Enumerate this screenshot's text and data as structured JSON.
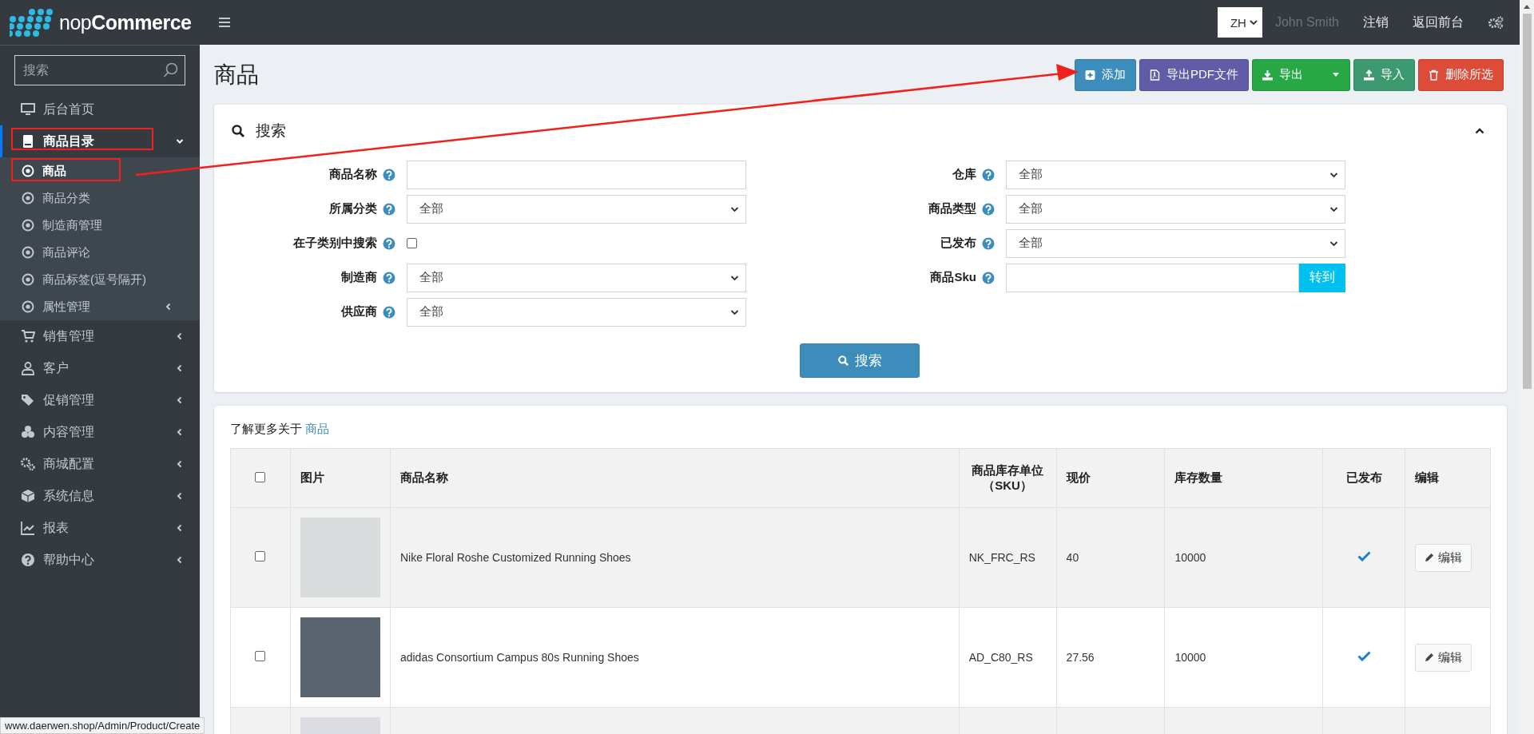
{
  "brand": {
    "name_light": "nop",
    "name_bold": "Commerce"
  },
  "sidebar": {
    "search": {
      "placeholder": "搜索"
    },
    "items": [
      {
        "label": "后台首页",
        "selected": false,
        "has_arrow": false
      },
      {
        "label": "商品目录",
        "selected": true,
        "expanded": true,
        "has_arrow": true,
        "children": [
          {
            "label": "商品",
            "selected": true,
            "has_arrow": false
          },
          {
            "label": "商品分类",
            "selected": false,
            "has_arrow": false
          },
          {
            "label": "制造商管理",
            "selected": false,
            "has_arrow": false
          },
          {
            "label": "商品评论",
            "selected": false,
            "has_arrow": false
          },
          {
            "label": "商品标签(逗号隔开)",
            "selected": false,
            "has_arrow": false
          },
          {
            "label": "属性管理",
            "selected": false,
            "has_arrow": true
          }
        ]
      },
      {
        "label": "销售管理",
        "selected": false,
        "expanded": false,
        "has_arrow": true
      },
      {
        "label": "客户",
        "selected": false,
        "expanded": false,
        "has_arrow": true
      },
      {
        "label": "促销管理",
        "selected": false,
        "expanded": false,
        "has_arrow": true
      },
      {
        "label": "内容管理",
        "selected": false,
        "expanded": false,
        "has_arrow": true
      },
      {
        "label": "商城配置",
        "selected": false,
        "expanded": false,
        "has_arrow": true
      },
      {
        "label": "系统信息",
        "selected": false,
        "expanded": false,
        "has_arrow": true
      },
      {
        "label": "报表",
        "selected": false,
        "expanded": false,
        "has_arrow": true
      },
      {
        "label": "帮助中心",
        "selected": false,
        "expanded": false,
        "has_arrow": true
      }
    ]
  },
  "header": {
    "language": "ZH",
    "user": "John Smith",
    "logout": "注销",
    "storefront": "返回前台"
  },
  "page_title": "商品",
  "actions": [
    {
      "kind": "add",
      "label": "添加"
    },
    {
      "kind": "pdf",
      "label": "导出PDF文件"
    },
    {
      "kind": "export",
      "label": "导出"
    },
    {
      "kind": "import",
      "label": "导入"
    },
    {
      "kind": "delete",
      "label": "删除所选"
    }
  ],
  "search_panel": {
    "title": "搜索",
    "expanded": true,
    "left_fields": [
      {
        "kind": "text",
        "label": "商品名称"
      },
      {
        "kind": "select",
        "label": "所属分类",
        "value": "全部"
      },
      {
        "kind": "checkbox",
        "label": "在子类别中搜索",
        "checked": false
      },
      {
        "kind": "select",
        "label": "制造商",
        "value": "全部"
      },
      {
        "kind": "select",
        "label": "供应商",
        "value": "全部"
      }
    ],
    "right_fields": [
      {
        "kind": "select",
        "label": "仓库",
        "value": "全部"
      },
      {
        "kind": "select",
        "label": "商品类型",
        "value": "全部"
      },
      {
        "kind": "select",
        "label": "已发布",
        "value": "全部"
      },
      {
        "kind": "go",
        "label": "商品Sku",
        "button": "转到"
      }
    ],
    "search_button": "搜索"
  },
  "learn_more": {
    "text": "了解更多关于",
    "link": "商品"
  },
  "table": {
    "columns": [
      "图片",
      "商品名称",
      "商品库存单位（SKU）",
      "现价",
      "库存数量",
      "已发布",
      "编辑"
    ],
    "select_all_checked": false,
    "rows": [
      {
        "kind": "full",
        "checked": false,
        "name": "Nike Floral Roshe Customized Running Shoes",
        "sku": "NK_FRC_RS",
        "price": "40",
        "stock": "10000",
        "published": true,
        "edit": "编辑"
      },
      {
        "kind": "full",
        "checked": false,
        "name": "adidas Consortium Campus 80s Running Shoes",
        "sku": "AD_C80_RS",
        "price": "27.56",
        "stock": "10000",
        "published": true,
        "edit": "编辑"
      },
      {
        "kind": "partial"
      }
    ]
  },
  "status_url": "www.daerwen.shop/Admin/Product/Create"
}
